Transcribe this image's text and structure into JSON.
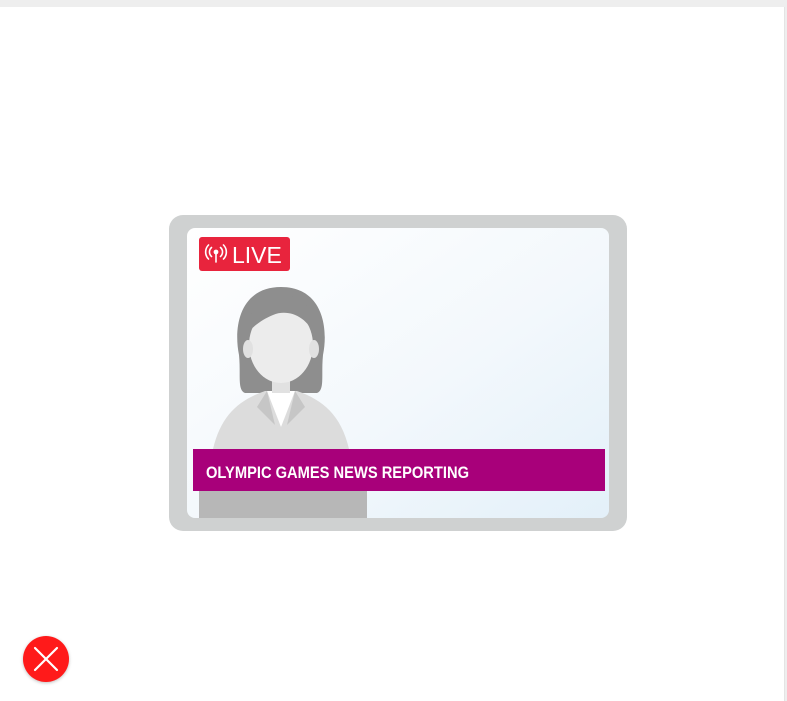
{
  "broadcast": {
    "live_label": "LIVE",
    "headline": "OLYMPIC GAMES NEWS REPORTING"
  },
  "colors": {
    "live_badge": "#e8243d",
    "headline_bar": "#a8007a",
    "close_button": "#ff1a1a",
    "frame": "#cfd1d1"
  },
  "icons": {
    "broadcast": "broadcast-antenna-icon",
    "close": "close-icon"
  }
}
